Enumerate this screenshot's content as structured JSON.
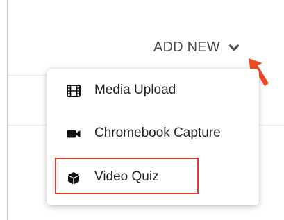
{
  "header": {
    "add_new_label": "ADD NEW",
    "chevron_icon": "chevron-down-icon"
  },
  "menu": {
    "items": [
      {
        "label": "Media Upload",
        "icon": "film-icon"
      },
      {
        "label": "Chromebook Capture",
        "icon": "video-camera-icon"
      },
      {
        "label": "Video Quiz",
        "icon": "cube-icon",
        "highlighted": true
      }
    ]
  },
  "annotation": {
    "arrow_color": "#f04a25",
    "highlight_color": "#e13d2b"
  }
}
